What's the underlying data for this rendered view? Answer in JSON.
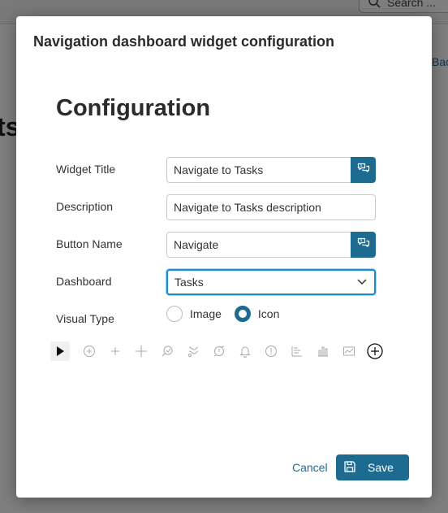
{
  "background": {
    "search_placeholder": "Search ...",
    "left_title_fragment": "ts",
    "back_link_fragment": "Bac"
  },
  "modal": {
    "title": "Navigation dashboard widget configuration",
    "heading": "Configuration",
    "fields": {
      "widget_title": {
        "label": "Widget Title",
        "value": "Navigate to Tasks"
      },
      "description": {
        "label": "Description",
        "value": "Navigate to Tasks description"
      },
      "button_name": {
        "label": "Button Name",
        "value": "Navigate"
      },
      "dashboard": {
        "label": "Dashboard",
        "selected": "Tasks"
      }
    },
    "visual_type": {
      "label": "Visual Type",
      "options": [
        "Image",
        "Icon"
      ],
      "selected": "Icon"
    },
    "icon_palette": [
      "play-icon",
      "add-circle-icon",
      "plus-small-icon",
      "plus-icon",
      "process-icon",
      "process-alt-icon",
      "alert-icon",
      "bell-icon",
      "exclamation-circle-icon",
      "bar-chart-horizontal-icon",
      "column-chart-icon",
      "line-chart-icon",
      "plus-circle-icon"
    ],
    "footer": {
      "cancel_label": "Cancel",
      "save_label": "Save"
    }
  },
  "colors": {
    "primary": "#1d6b91",
    "focus": "#1a8fc7"
  }
}
